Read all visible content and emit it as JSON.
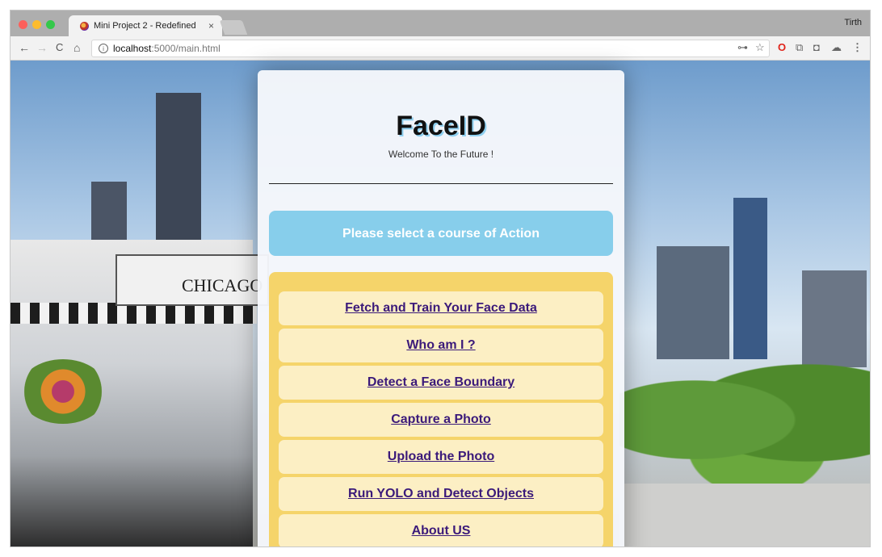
{
  "browser": {
    "tab_title": "Mini Project 2 - Redefined",
    "tab_close": "×",
    "user_name": "Tirth",
    "url_host": "localhost",
    "url_path": ":5000/main.html",
    "nav": {
      "back": "←",
      "forward": "→",
      "reload": "C",
      "home": "⌂"
    },
    "extensions": {
      "key": "⊶",
      "star": "☆",
      "opera": "O",
      "cast": "⧉",
      "shield": "◘",
      "cloud": "☁",
      "menu": "⋮"
    }
  },
  "background": {
    "sign_text": "CHICAGO"
  },
  "app": {
    "title": "FaceID",
    "tagline": "Welcome To the Future !",
    "prompt": "Please select a course of Action",
    "menu": [
      {
        "label": "Fetch and Train Your Face Data"
      },
      {
        "label": "Who am I ?"
      },
      {
        "label": "Detect a Face Boundary"
      },
      {
        "label": "Capture a Photo"
      },
      {
        "label": "Upload the Photo"
      },
      {
        "label": "Run YOLO and Detect Objects"
      },
      {
        "label": "About US"
      }
    ]
  }
}
